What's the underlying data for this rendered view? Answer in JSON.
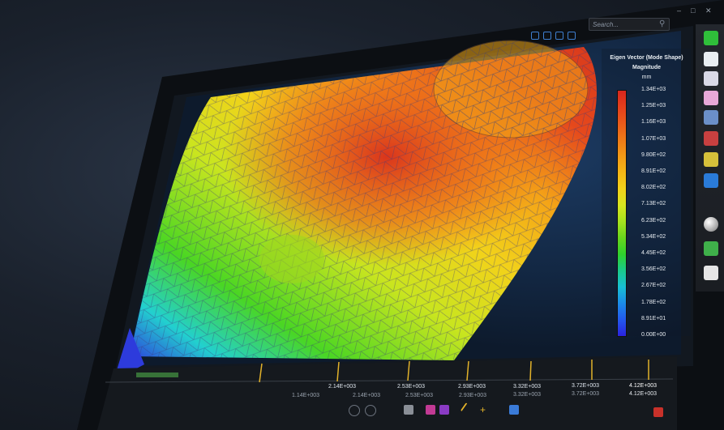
{
  "search": {
    "placeholder": "Search..."
  },
  "window_controls": [
    "minimize-icon",
    "restore-icon",
    "close-icon"
  ],
  "toolbar_icons": [
    "view-icon",
    "rotate-icon",
    "fit-icon",
    "axis-icon"
  ],
  "legend": {
    "title": "Eigen Vector (Mode Shape)",
    "subtitle": "Magnitude",
    "unit": "mm",
    "ticks": [
      "1.34E+03",
      "1.25E+03",
      "1.16E+03",
      "1.07E+03",
      "9.80E+02",
      "8.91E+02",
      "8.02E+02",
      "7.13E+02",
      "6.23E+02",
      "5.34E+02",
      "4.45E+02",
      "3.56E+02",
      "2.67E+02",
      "1.78E+02",
      "8.91E+01",
      "0.00E+00"
    ],
    "colors": [
      "#d7261d",
      "#e43f1c",
      "#ea5a1a",
      "#ef7a17",
      "#f39a16",
      "#f5b715",
      "#f2d21a",
      "#d8e61f",
      "#a6e31e",
      "#68d61d",
      "#2fd12d",
      "#19c98c",
      "#18bfd4",
      "#1b8be8",
      "#2358ed",
      "#2a23df"
    ]
  },
  "timeline": {
    "values_top": [
      "2.14E+003",
      "2.53E+003",
      "2.93E+003",
      "3.32E+003",
      "3.72E+003",
      "4.12E+003"
    ],
    "values_bottom": [
      "1.14E+003",
      "2.14E+003",
      "2.53E+003",
      "2.93E+003",
      "3.32E+003",
      "3.72E+003",
      "4.12E+003"
    ],
    "accent": "#e2b22a"
  },
  "side_rail": {
    "buttons": [
      "model-icon",
      "mesh-icon",
      "load-icon",
      "material-icon",
      "table-icon",
      "chart-icon",
      "sensor-icon",
      "sphere-icon",
      "layers-icon",
      "graph-icon"
    ]
  },
  "bottom_toolbar": {
    "buttons": [
      "rewind-icon",
      "play-icon",
      "cube-view-icon",
      "chart-view-icon",
      "pen-tool-icon",
      "plus-tool-icon",
      "grid-icon"
    ]
  },
  "exit_icon": "exit-icon"
}
